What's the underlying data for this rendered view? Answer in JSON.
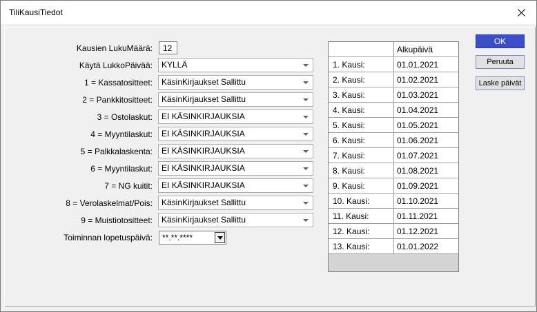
{
  "window": {
    "title": "TiliKausiTiedot"
  },
  "form": {
    "count_label": "Kausien LukuMäärä:",
    "count_value": "12",
    "rows": [
      {
        "label": "Käytä LukkoPäivää:",
        "value": "KYLLÄ"
      },
      {
        "label": "1 = Kassatositteet:",
        "value": "KäsinKirjaukset Sallittu"
      },
      {
        "label": "2 = Pankkitositteet:",
        "value": "KäsinKirjaukset Sallittu"
      },
      {
        "label": "3 = Ostolaskut:",
        "value": "EI KÄSINKIRJAUKSIA"
      },
      {
        "label": "4 = Myyntilaskut:",
        "value": "EI KÄSINKIRJAUKSIA"
      },
      {
        "label": "5 = Palkkalaskenta:",
        "value": "EI KÄSINKIRJAUKSIA"
      },
      {
        "label": "6 = Myyntilaskut:",
        "value": "EI KÄSINKIRJAUKSIA"
      },
      {
        "label": "7 = NG kuitit:",
        "value": "EI KÄSINKIRJAUKSIA"
      },
      {
        "label": "8 = Verolaskelmat/Pois:",
        "value": "KäsinKirjaukset Sallittu"
      },
      {
        "label": "9 = Muistiotositteet:",
        "value": "KäsinKirjaukset Sallittu"
      }
    ],
    "end_date_label": "Toiminnan lopetuspäivä:",
    "end_date_value": "**.**.****"
  },
  "grid": {
    "header": [
      "",
      "Alkupäivä"
    ],
    "rows": [
      [
        "1. Kausi:",
        "01.01.2021"
      ],
      [
        "2. Kausi:",
        "01.02.2021"
      ],
      [
        "3. Kausi:",
        "01.03.2021"
      ],
      [
        "4. Kausi:",
        "01.04.2021"
      ],
      [
        "5. Kausi:",
        "01.05.2021"
      ],
      [
        "6. Kausi:",
        "01.06.2021"
      ],
      [
        "7. Kausi:",
        "01.07.2021"
      ],
      [
        "8. Kausi:",
        "01.08.2021"
      ],
      [
        "9. Kausi:",
        "01.09.2021"
      ],
      [
        "10. Kausi:",
        "01.10.2021"
      ],
      [
        "11. Kausi:",
        "01.11.2021"
      ],
      [
        "12. Kausi:",
        "01.12.2021"
      ],
      [
        "13. Kausi:",
        "01.01.2022"
      ]
    ]
  },
  "buttons": {
    "ok": "OK",
    "cancel": "Peruuta",
    "calc": "Laske päivät"
  },
  "colors": {
    "accent": "#3a4fc8",
    "panel": "#f0f0f0"
  }
}
